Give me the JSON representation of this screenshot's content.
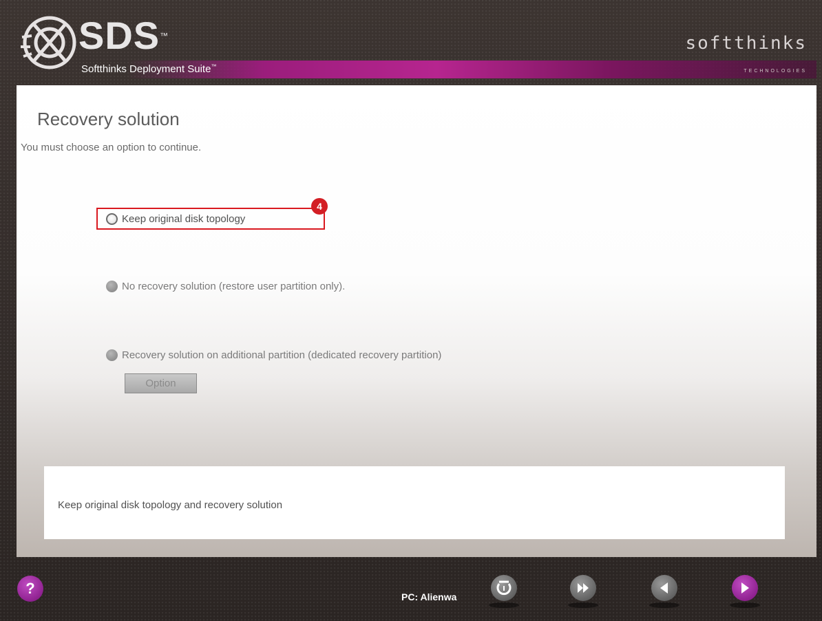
{
  "header": {
    "logo_text": "SDS",
    "logo_tm": "™",
    "product_name": "Softthinks Deployment Suite",
    "product_tm": "™",
    "brand": "softthinks",
    "brand_sub": "TECHNOLOGIES"
  },
  "page": {
    "title": "Recovery solution",
    "subtitle": "You must choose an option to continue."
  },
  "options": [
    {
      "label": "Keep original disk topology",
      "selected": false,
      "enabled": true
    },
    {
      "label": "No recovery solution (restore user partition only).",
      "selected": false,
      "enabled": false
    },
    {
      "label": "Recovery solution on additional partition (dedicated recovery partition)",
      "selected": false,
      "enabled": false
    }
  ],
  "callout_number": "4",
  "option_button_label": "Option",
  "description": "Keep original disk topology and recovery solution",
  "footer": {
    "help_label": "?",
    "pc_label": "PC: Alienwa"
  },
  "icons": {
    "help": "question-icon",
    "refresh": "refresh-icon",
    "fast_forward": "fast-forward-icon",
    "back": "back-icon",
    "next": "next-icon"
  },
  "colors": {
    "accent": "#9b1d7c",
    "highlight": "#d31e24"
  }
}
